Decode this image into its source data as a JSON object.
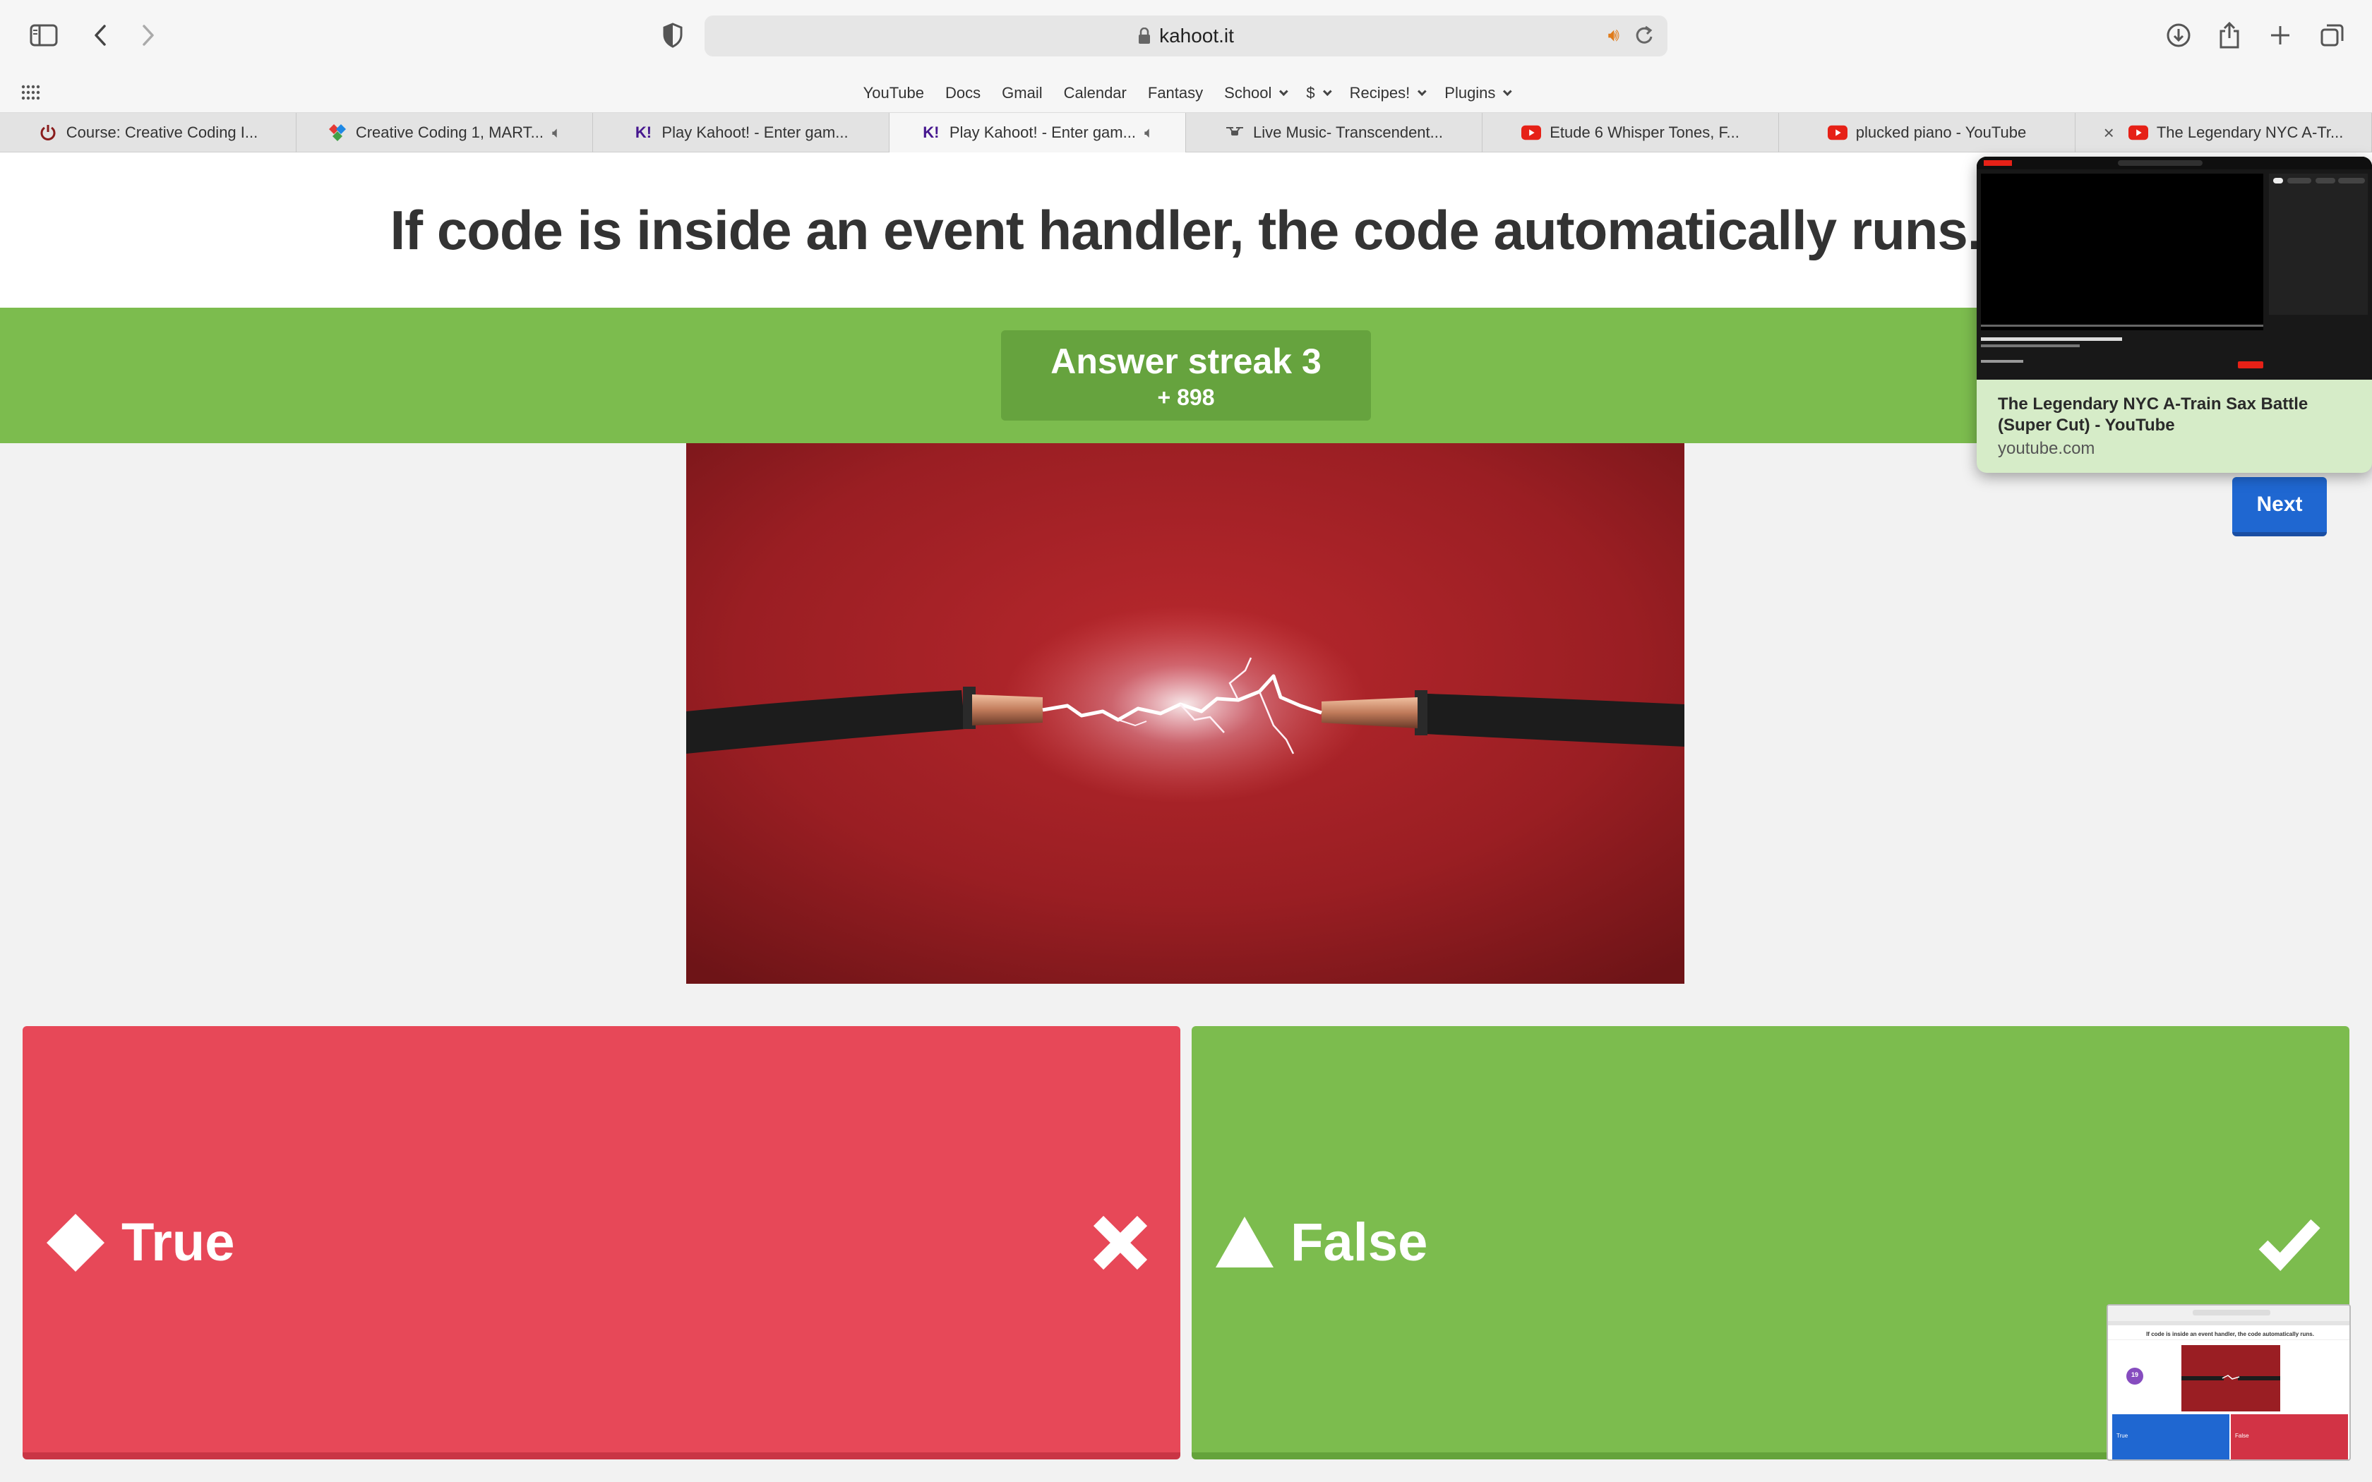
{
  "browser": {
    "url": "kahoot.it",
    "favorites": [
      {
        "label": "YouTube",
        "dropdown": false
      },
      {
        "label": "Docs",
        "dropdown": false
      },
      {
        "label": "Gmail",
        "dropdown": false
      },
      {
        "label": "Calendar",
        "dropdown": false
      },
      {
        "label": "Fantasy",
        "dropdown": false
      },
      {
        "label": "School",
        "dropdown": true
      },
      {
        "label": "$",
        "dropdown": true
      },
      {
        "label": "Recipes!",
        "dropdown": true
      },
      {
        "label": "Plugins",
        "dropdown": true
      }
    ],
    "tabs": [
      {
        "title": "Course: Creative Coding I...",
        "icon": "power-icon"
      },
      {
        "title": "Creative Coding 1, MART...",
        "icon": "colorful-diamond-icon"
      },
      {
        "title": "Play Kahoot! - Enter gam...",
        "icon": "kahoot-icon"
      },
      {
        "title": "Play Kahoot! - Enter gam...",
        "icon": "kahoot-icon"
      },
      {
        "title": "Live Music- Transcendent...",
        "icon": "drone-icon"
      },
      {
        "title": "Etude 6 Whisper Tones, F...",
        "icon": "youtube-icon"
      },
      {
        "title": "plucked piano - YouTube",
        "icon": "youtube-icon"
      },
      {
        "title": "The Legendary NYC A-Tr...",
        "icon": "youtube-icon"
      }
    ]
  },
  "kahoot": {
    "question": "If code is inside an event handler, the code automatically runs.",
    "streak": {
      "title": "Answer streak 3",
      "points": "+ 898"
    },
    "next_label": "Next",
    "answers": {
      "true_label": "True",
      "false_label": "False"
    }
  },
  "tab_preview": {
    "title": "The Legendary NYC A-Train Sax Battle (Super Cut) - YouTube",
    "host": "youtube.com"
  },
  "mini_screen": {
    "question": "If code is inside an event handler, the code automatically runs.",
    "counter": "19",
    "true_label": "True",
    "false_label": "False"
  },
  "colors": {
    "kahoot_red": "#e74858",
    "kahoot_green": "#7cbc4e",
    "kahoot_blue": "#1f67d1",
    "kahoot_purple": "#46178f"
  }
}
